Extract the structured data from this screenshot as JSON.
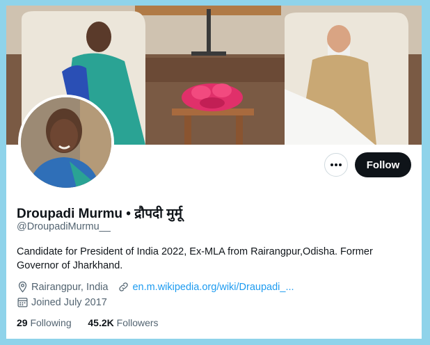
{
  "profile": {
    "name": "Droupadi Murmu • द्रौपदी मुर्मू",
    "handle": "@DroupadiMurmu__",
    "bio": "Candidate for President of India 2022, Ex-MLA from Rairangpur,Odisha. Former Governor of Jharkhand.",
    "location": "Rairangpur, India",
    "website": "en.m.wikipedia.org/wiki/Draupadi_...",
    "joined": "Joined July 2017",
    "following_count": "29",
    "following_label": "Following",
    "followers_count": "45.2K",
    "followers_label": "Followers"
  },
  "actions": {
    "follow_label": "Follow",
    "more_icon": "more-horizontal-icon"
  },
  "colors": {
    "page_bg": "#8fd3ea",
    "follow_bg": "#0f1419",
    "link": "#1d9bf0",
    "secondary_text": "#536471"
  }
}
